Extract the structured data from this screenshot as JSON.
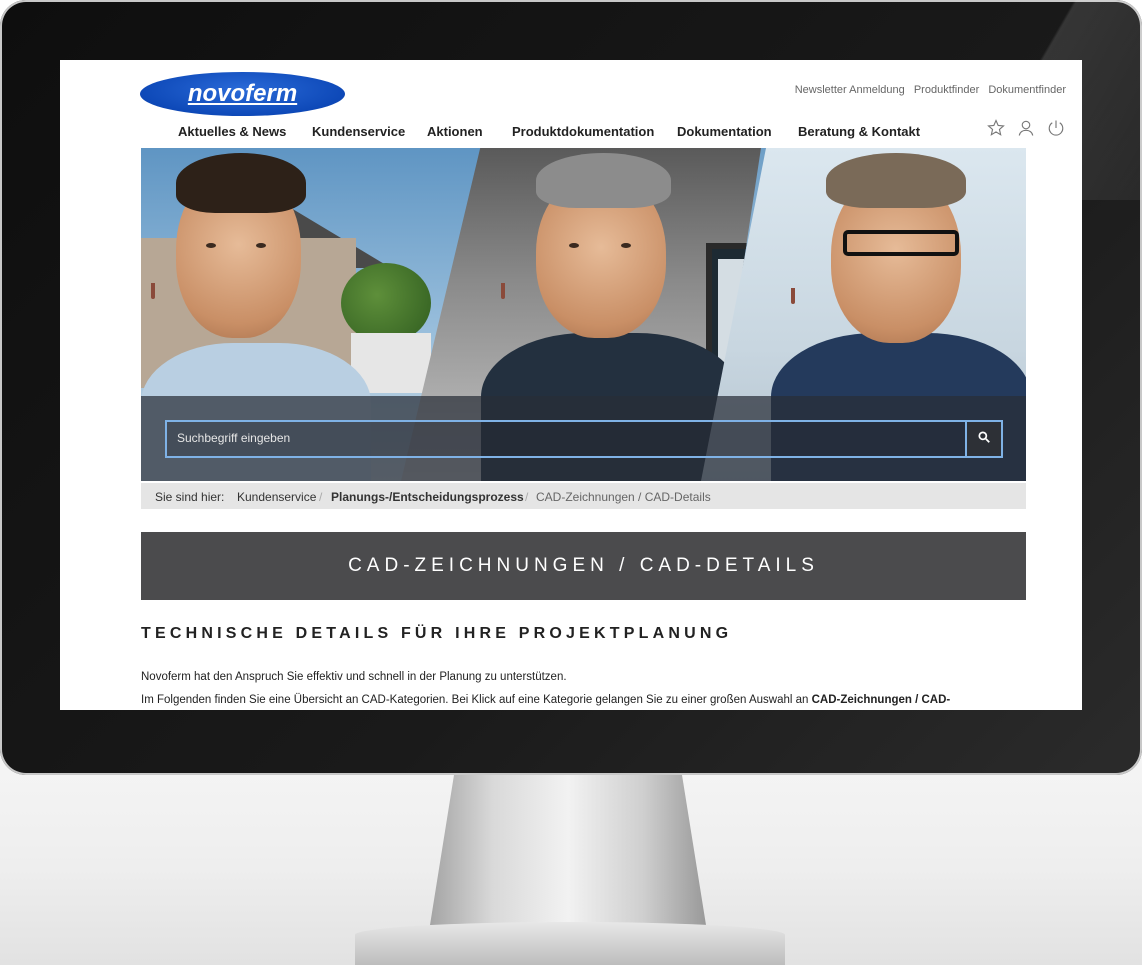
{
  "site": {
    "logo_text": "novoferm"
  },
  "toplinks": [
    "Newsletter Anmeldung",
    "Produktfinder",
    "Dokumentfinder"
  ],
  "nav": [
    "Aktuelles & News",
    "Kundenservice",
    "Aktionen",
    "Produktdokumentation",
    "Dokumentation",
    "Beratung & Kontakt"
  ],
  "icons": [
    "star-icon",
    "user-icon",
    "power-icon",
    "search-icon"
  ],
  "search": {
    "placeholder": "Suchbegriff eingeben"
  },
  "breadcrumb": {
    "prefix": "Sie sind hier:",
    "items": [
      "Kundenservice",
      "Planungs-/Entscheidungsprozess",
      "CAD-Zeichnungen / CAD-Details"
    ]
  },
  "page": {
    "title": "CAD-ZEICHNUNGEN / CAD-DETAILS",
    "heading": "TECHNISCHE DETAILS FÜR IHRE PROJEKTPLANUNG",
    "para1": "Novoferm hat den Anspruch Sie effektiv und schnell in der Planung zu unterstützen.",
    "para2_start": "Im Folgenden finden Sie eine Übersicht an CAD-Kategorien. Bei Klick auf eine Kategorie gelangen Sie zu einer großen Auswahl an ",
    "para2_bold": "CAD-Zeichnungen / CAD-"
  },
  "colors": {
    "brand_blue": "#0e49b8",
    "title_bar": "#4b4b4d",
    "search_border": "#7fb2e6"
  }
}
